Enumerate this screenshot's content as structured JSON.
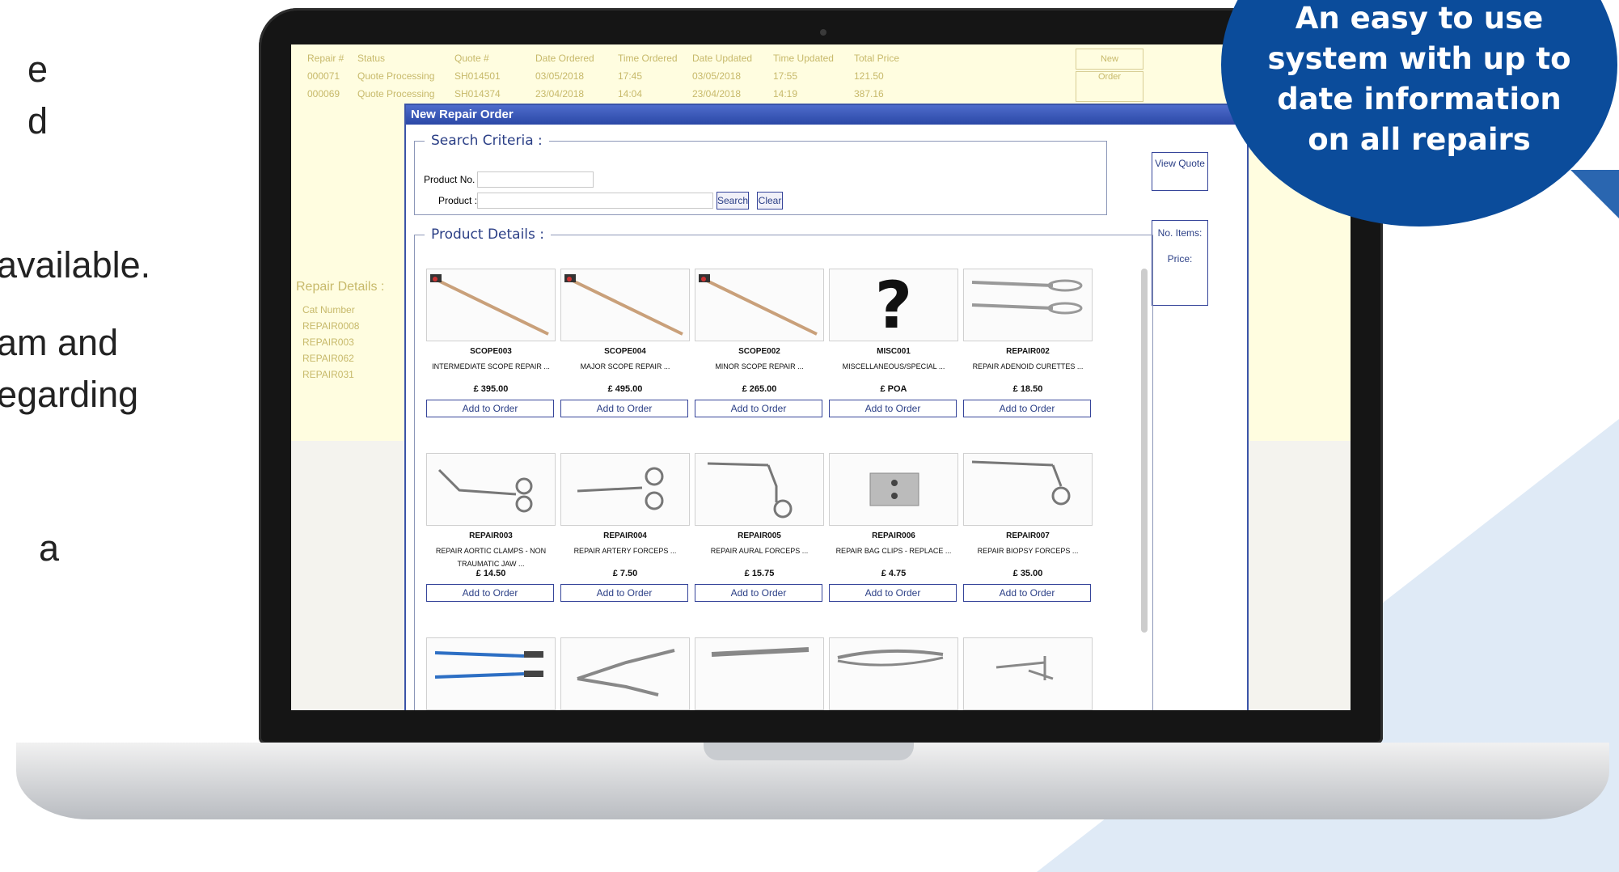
{
  "left_text": [
    "e",
    "d",
    "available.",
    "am and",
    "egarding",
    "a"
  ],
  "badge": {
    "text": "An easy to use system with up to date information on all repairs",
    "color": "#0b4c9b"
  },
  "bg_app": {
    "headers": [
      "Repair #",
      "Status",
      "Quote #",
      "Date Ordered",
      "Time Ordered",
      "Date Updated",
      "Time Updated",
      "Total Price"
    ],
    "rows": [
      [
        "000071",
        "Quote Processing",
        "SH014501",
        "03/05/2018",
        "17:45",
        "03/05/2018",
        "17:55",
        "121.50"
      ],
      [
        "000069",
        "Quote Processing",
        "SH014374",
        "23/04/2018",
        "14:04",
        "23/04/2018",
        "14:19",
        "387.16"
      ]
    ],
    "new_button": "New",
    "order_button": "Order",
    "details_title": "Repair Details :",
    "details_col": "Cat Number",
    "details_items": [
      "REPAIR0008",
      "REPAIR003",
      "REPAIR062",
      "REPAIR031"
    ]
  },
  "modal": {
    "title": "New Repair Order",
    "close": "x",
    "search_legend": "Search Criteria :",
    "product_no_label": "Product No. :",
    "product_label": "Product :",
    "search_button": "Search",
    "clear_button": "Clear",
    "view_quote_button": "View Quote",
    "details_legend": "Product Details :",
    "no_items_label": "No. Items:",
    "price_label": "Price:",
    "add_label": "Add to Order",
    "products": [
      {
        "code": "SCOPE003",
        "name": "INTERMEDIATE SCOPE REPAIR ...",
        "price": "£ 395.00",
        "icon": "scope-icon"
      },
      {
        "code": "SCOPE004",
        "name": "MAJOR SCOPE REPAIR ...",
        "price": "£ 495.00",
        "icon": "scope-icon"
      },
      {
        "code": "SCOPE002",
        "name": "MINOR SCOPE REPAIR ...",
        "price": "£ 265.00",
        "icon": "scope-icon"
      },
      {
        "code": "MISC001",
        "name": "MISCELLANEOUS/SPECIAL ...",
        "price": "£ POA",
        "icon": "question-mark-icon"
      },
      {
        "code": "REPAIR002",
        "name": "REPAIR ADENOID CURETTES ...",
        "price": "£ 18.50",
        "icon": "curette-icon"
      },
      {
        "code": "REPAIR003",
        "name": "REPAIR AORTIC CLAMPS - NON TRAUMATIC JAW ...",
        "price": "£ 14.50",
        "icon": "clamp-icon"
      },
      {
        "code": "REPAIR004",
        "name": "REPAIR ARTERY FORCEPS ...",
        "price": "£ 7.50",
        "icon": "forceps-icon"
      },
      {
        "code": "REPAIR005",
        "name": "REPAIR AURAL FORCEPS ...",
        "price": "£ 15.75",
        "icon": "aural-forceps-icon"
      },
      {
        "code": "REPAIR006",
        "name": "REPAIR BAG CLIPS - REPLACE ...",
        "price": "£ 4.75",
        "icon": "bag-clip-icon"
      },
      {
        "code": "REPAIR007",
        "name": "REPAIR BIOPSY FORCEPS ...",
        "price": "£ 35.00",
        "icon": "biopsy-forceps-icon"
      },
      {
        "code": "",
        "name": "",
        "price": "",
        "icon": "bipolar-forceps-icon"
      },
      {
        "code": "",
        "name": "",
        "price": "",
        "icon": "speculum-icon"
      },
      {
        "code": "",
        "name": "",
        "price": "",
        "icon": "scalpel-icon"
      },
      {
        "code": "",
        "name": "",
        "price": "",
        "icon": "micro-forceps-icon"
      },
      {
        "code": "",
        "name": "",
        "price": "",
        "icon": "retractor-icon"
      }
    ]
  }
}
